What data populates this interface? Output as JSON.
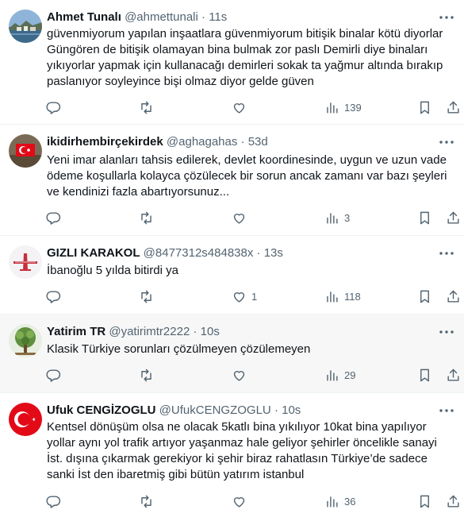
{
  "tweets": [
    {
      "name": "Ahmet Tunalı",
      "handle": "@ahmettunali",
      "dot": "·",
      "time": "11s",
      "text": "güvenmiyorum yapılan inşaatlara güvenmiyorum bitişik binalar kötü diyorlar\nGüngören de bitişik olamayan bina bulmak zor paslı Demirli diye binaları\nyıkıyorlar yapmak için kullanacağı demirleri sokak ta yağmur altında bırakıp\npaslanıyor soyleyince bişi olmaz diyor gelde güven",
      "replies": "",
      "retweets": "",
      "likes": "",
      "views": "139"
    },
    {
      "name": "ikidirhembirçekirdek",
      "handle": "@aghagahas",
      "dot": "·",
      "time": "53d",
      "text": "Yeni imar alanları tahsis edilerek, devlet koordinesinde, uygun ve uzun vade\nödeme koşullarla kolayca çözülecek bir sorun ancak zamanı var bazı şeyleri\nve kendinizi fazla abartıyorsunuz...",
      "replies": "",
      "retweets": "",
      "likes": "",
      "views": "3"
    },
    {
      "name": "GIZLI KARAKOL",
      "handle": "@8477312s484838x",
      "dot": "·",
      "time": "13s",
      "text": "İbanoğlu 5 yılda bitirdi ya",
      "replies": "",
      "retweets": "",
      "likes": "1",
      "views": "118"
    },
    {
      "name": "Yatirim TR",
      "handle": "@yatirimtr2222",
      "dot": "·",
      "time": "10s",
      "text": "Klasik Türkiye sorunları çözülmeyen çözülemeyen",
      "replies": "",
      "retweets": "",
      "likes": "",
      "views": "29"
    },
    {
      "name": "Ufuk CENGİZOGLU",
      "handle": "@UfukCENGZOGLU",
      "dot": "·",
      "time": "10s",
      "text": "Kentsel dönüşüm olsa ne olacak 5katlı bina yıkılıyor 10kat bina yapılıyor\nyollar aynı yol trafik artıyor yaşanmaz hale geliyor şehirler öncelikle sanayi\nİst. dışına çıkarmak gerekiyor ki şehir biraz rahatlasın Türkiye’de sadece\nsanki İst den ibaretmiş gibi bütün yatırım istanbul",
      "replies": "",
      "retweets": "",
      "likes": "",
      "views": "36"
    }
  ],
  "colors": {
    "text": "#0f1419",
    "muted": "#536471",
    "divider": "#eff3f4",
    "highlight_bg": "#f7f7f7",
    "flag_red": "#e30a17"
  },
  "icons": [
    "more-icon",
    "reply-icon",
    "retweet-icon",
    "like-icon",
    "views-icon",
    "bookmark-icon",
    "share-icon"
  ]
}
